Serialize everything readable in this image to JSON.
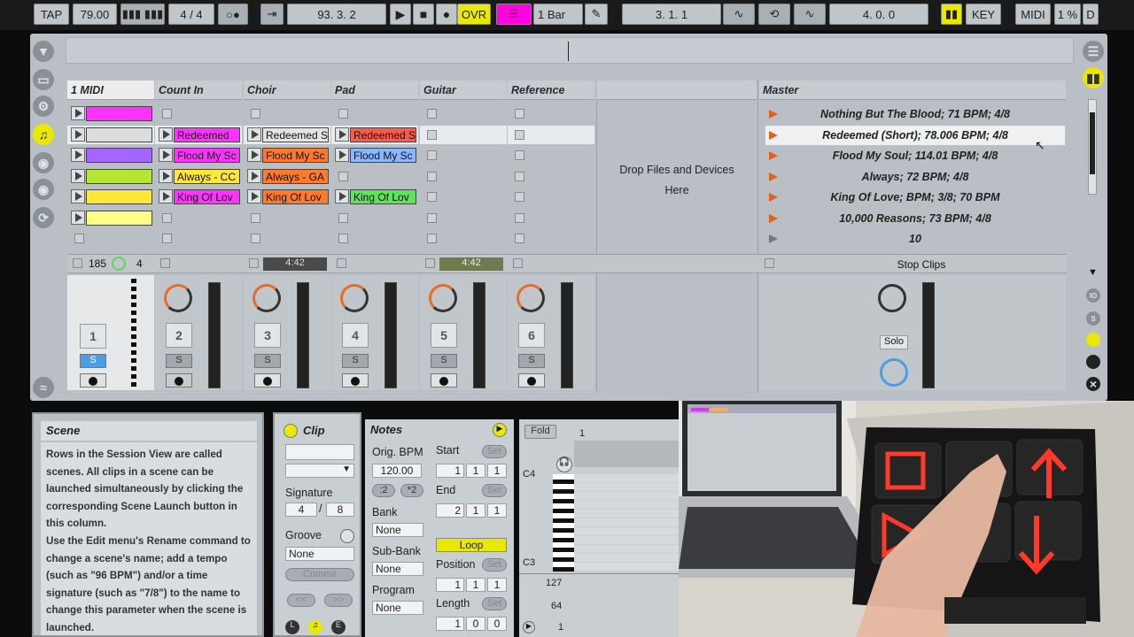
{
  "topbar": {
    "tap": "TAP",
    "tempo": "79.00",
    "sig_num": "4",
    "sig_den": "4",
    "transport_pos": "93.   3.   2",
    "ovr": "OVR",
    "quant": "1 Bar",
    "loop_start": "3.   1.   1",
    "loop_len": "4.   0.   0",
    "key": "KEY",
    "midi": "MIDI",
    "cpu": "1 %",
    "disk": "D"
  },
  "tracks": [
    {
      "name": "1 MIDI",
      "selected": true
    },
    {
      "name": "Count In"
    },
    {
      "name": "Choir"
    },
    {
      "name": "Pad"
    },
    {
      "name": "Guitar"
    },
    {
      "name": "Reference"
    }
  ],
  "clips": {
    "midi": [
      "",
      "",
      "",
      "",
      "",
      ""
    ],
    "count_in": [
      "",
      "Redeemed",
      "Flood My Sc",
      "Always - CC",
      "King Of Lov"
    ],
    "choir": [
      "",
      "Redeemed S",
      "Flood My Sc",
      "Always - GA",
      "King Of Lov"
    ],
    "pad": [
      "",
      "Redeemed S",
      "Flood My Sc",
      "",
      "King Of Lov"
    ]
  },
  "drop_zone": {
    "line1": "Drop Files and Devices",
    "line2": "Here"
  },
  "master": {
    "title": "Master",
    "scenes": [
      "Nothing But The Blood; 71 BPM; 4/8",
      "Redeemed (Short); 78.006 BPM; 4/8",
      "Flood My Soul; 114.01 BPM; 4/8",
      "Always; 72 BPM; 4/8",
      "King Of Love; BPM; 3/8; 70 BPM",
      "10,000 Reasons; 73 BPM; 4/8",
      "10"
    ],
    "stop_clips": "Stop Clips",
    "solo": "Solo"
  },
  "mixer": {
    "midi_status": {
      "tempo": "185",
      "num": "4"
    },
    "choir_time": "4:42",
    "guitar_time": "4:42",
    "track_numbers": [
      "1",
      "2",
      "3",
      "4",
      "5",
      "6"
    ],
    "solo_label": "S"
  },
  "info": {
    "title": "Scene",
    "text": "Rows in the Session View are called scenes. All clips in a scene can be launched simultaneously by clicking the corresponding Scene Launch button in this column.\nUse the Edit menu's Rename command to change a scene's name; add a tempo (such as \"96 BPM\") and/or a time signature (such as \"7/8\") to the name to change this parameter when the scene is launched."
  },
  "clip_panel": {
    "title": "Clip",
    "signature_label": "Signature",
    "sig_num": "4",
    "sig_den": "8",
    "groove_label": "Groove",
    "groove_value": "None",
    "commit": "Commit",
    "nav_left": "<<",
    "nav_right": ">>"
  },
  "notes_panel": {
    "title": "Notes",
    "orig_bpm_label": "Orig. BPM",
    "orig_bpm": "120.00",
    "half": ":2",
    "double": "*2",
    "bank_label": "Bank",
    "bank": "None",
    "subbank_label": "Sub-Bank",
    "subbank": "None",
    "program_label": "Program",
    "program": "None",
    "start_label": "Start",
    "start": [
      "1",
      "1",
      "1"
    ],
    "end_label": "End",
    "end": [
      "2",
      "1",
      "1"
    ],
    "loop": "Loop",
    "position_label": "Position",
    "position": [
      "1",
      "1",
      "1"
    ],
    "length_label": "Length",
    "length": [
      "1",
      "0",
      "0"
    ],
    "set": "Set"
  },
  "piano": {
    "fold": "Fold",
    "bar": "1",
    "c4": "C4",
    "c3": "C3",
    "vel": [
      "127",
      "64",
      "1"
    ]
  },
  "colors": {
    "magenta": "#ff33ff",
    "purple": "#a566ff",
    "lime": "#b6e533",
    "yellow": "#ffe83a",
    "paleyellow": "#ffff88",
    "orange": "#ff7a2a",
    "green": "#5fe35f",
    "blue": "#8ab7ff",
    "red": "#ff5a4a"
  }
}
